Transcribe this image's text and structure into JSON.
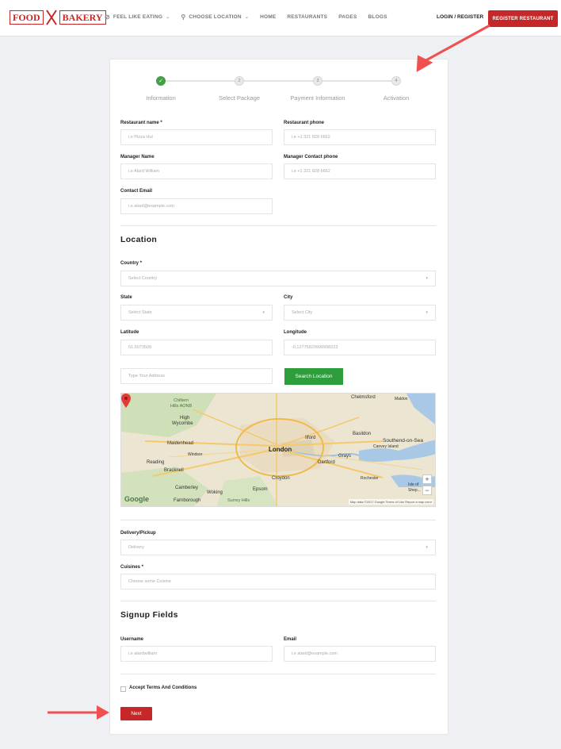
{
  "header": {
    "logo_left": "FOOD",
    "logo_right": "BAKERY",
    "nav": [
      {
        "label": "FEEL LIKE EATING",
        "icon": "utensils-icon",
        "dropdown": true
      },
      {
        "label": "CHOOSE LOCATION",
        "icon": "map-pin-icon",
        "dropdown": true
      },
      {
        "label": "HOME"
      },
      {
        "label": "RESTAURANTS"
      },
      {
        "label": "PAGES"
      },
      {
        "label": "BLOGS"
      }
    ],
    "login_label": "LOGIN / REGISTER",
    "register_label": "REGISTER RESTAURANT"
  },
  "steps": [
    {
      "label": "Information",
      "number": "",
      "done": true
    },
    {
      "label": "Select Package",
      "number": "2",
      "done": false
    },
    {
      "label": "Payment Information",
      "number": "3",
      "done": false
    },
    {
      "label": "Activation",
      "number": "4",
      "done": false
    }
  ],
  "form": {
    "restaurant_name_label": "Restaurant name *",
    "restaurant_name_placeholder": "i.e Pizza Hut",
    "restaurant_phone_label": "Restaurant phone",
    "restaurant_phone_placeholder": "i.e +1 321 828 6662",
    "manager_name_label": "Manager Name",
    "manager_name_placeholder": "i.e Alard William",
    "manager_phone_label": "Manager Contact phone",
    "manager_phone_placeholder": "i.e +1 321 828 6662",
    "contact_email_label": "Contact Email",
    "contact_email_placeholder": "i.e alard@example.com"
  },
  "location": {
    "title": "Location",
    "country_label": "Country *",
    "country_placeholder": "Select Country",
    "state_label": "State",
    "state_placeholder": "Select State",
    "city_label": "City",
    "city_placeholder": "Select City",
    "latitude_label": "Latitude",
    "latitude_value": "51.5073509",
    "longitude_label": "Longitude",
    "longitude_value": "-0.12775829999998223",
    "address_placeholder": "Type Your Address",
    "search_label": "Search Location"
  },
  "map": {
    "places": {
      "chelmsford": "Chelmsford",
      "maldon": "Maldon",
      "chiltern": "Chiltern",
      "hills": "Hills AONB",
      "high": "High",
      "wycombe": "Wycombe",
      "ilford": "Ilford",
      "basildon": "Basildon",
      "southend": "Southend-on-Sea",
      "canvey": "Canvey Island",
      "maidenhead": "Maidenhead",
      "london": "London",
      "windsor": "Windsor",
      "grays": "Grays",
      "dartford": "Dartford",
      "reading": "Reading",
      "bracknell": "Bracknell",
      "croydon": "Croydon",
      "rochester": "Rochester",
      "camberley": "Camberley",
      "woking": "Woking",
      "epsom": "Epsom",
      "farnborough": "Farnborough",
      "surrey": "Surrey Hills",
      "isle": "Isle of",
      "sheppey": "Shep..."
    },
    "google": "Google",
    "attribution": "Map data ©2017 Google   Terms of Use   Report a map error",
    "zoom_in": "+",
    "zoom_out": "−"
  },
  "delivery": {
    "label": "Delivery/Pickup",
    "value": "Delivery",
    "cuisines_label": "Cuisines *",
    "cuisines_placeholder": "Choose some Cuisine"
  },
  "signup": {
    "title": "Signup Fields",
    "username_label": "Username",
    "username_placeholder": "i.e alardwilliam",
    "email_label": "Email",
    "email_placeholder": "i.e alard@example.com",
    "terms_label": "Accept Terms And Conditions",
    "next_label": "Next"
  },
  "colors": {
    "brand_red": "#c62828",
    "success_green": "#2e9d3b",
    "arrow": "#f05050"
  }
}
